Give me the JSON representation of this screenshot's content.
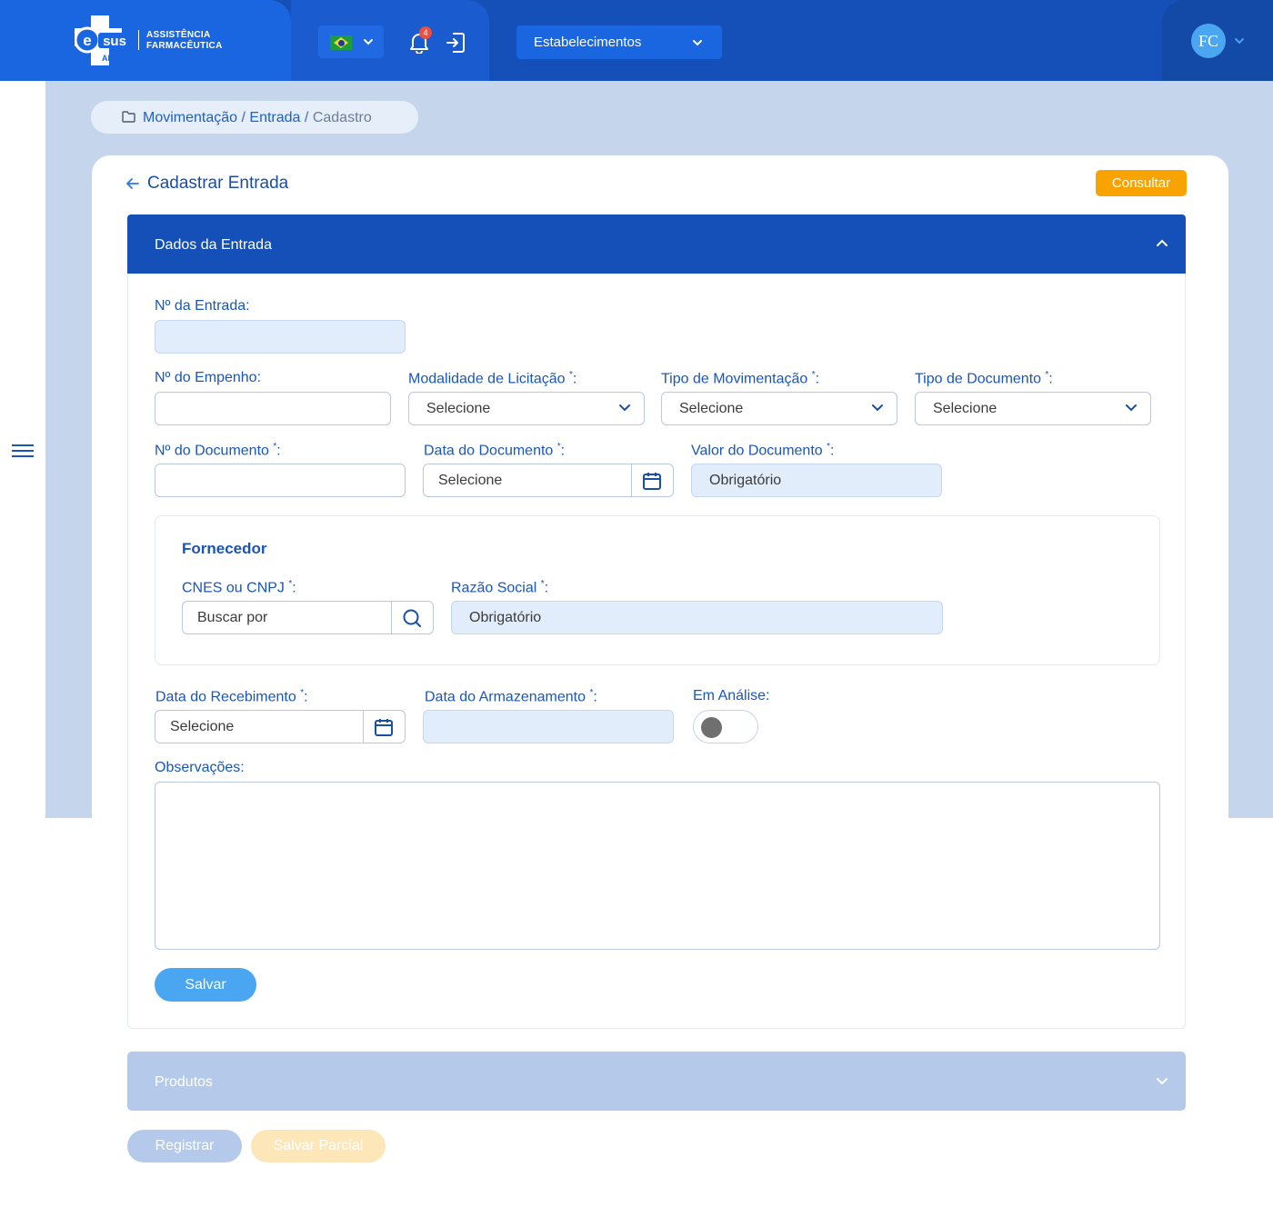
{
  "header": {
    "logo_line1": "ASSISTÊNCIA",
    "logo_line2": "FARMACÊUTICA",
    "logo_brand": "sus",
    "logo_sub": "AF",
    "notification_count": "4",
    "establishment_label": "Estabelecimentos",
    "user_initials": "FC"
  },
  "breadcrumb": {
    "items": [
      "Movimentação",
      "Entrada",
      "Cadastro"
    ],
    "separator": "/"
  },
  "page": {
    "title": "Cadastrar Entrada",
    "consult_button": "Consultar"
  },
  "section": {
    "title": "Dados da Entrada"
  },
  "form": {
    "numero_entrada": {
      "label": "Nº da Entrada:",
      "value": ""
    },
    "numero_empenho": {
      "label": "Nº do Empenho:",
      "value": ""
    },
    "modalidade": {
      "label": "Modalidade de Licitação ",
      "req": "*",
      "colon": ":",
      "value": "Selecione"
    },
    "tipo_mov": {
      "label": "Tipo de Movimentação ",
      "req": "*",
      "colon": ":",
      "value": "Selecione"
    },
    "tipo_doc": {
      "label": "Tipo de Documento ",
      "req": "*",
      "colon": ":",
      "value": "Selecione"
    },
    "numero_doc": {
      "label": "Nº do Documento ",
      "req": "*",
      "colon": ":",
      "value": ""
    },
    "data_doc": {
      "label": "Data do Documento ",
      "req": "*",
      "colon": ":",
      "value": "Selecione"
    },
    "valor_doc": {
      "label": "Valor do Documento ",
      "req": "*",
      "colon": ":",
      "value": "Obrigatório"
    },
    "fornecedor": {
      "title": "Fornecedor",
      "cnes": {
        "label": "CNES ou CNPJ ",
        "req": "*",
        "colon": ":",
        "placeholder": "Buscar por"
      },
      "razao": {
        "label": "Razão Social ",
        "req": "*",
        "colon": ":",
        "value": "Obrigatório"
      }
    },
    "data_receb": {
      "label": "Data do Recebimento ",
      "req": "*",
      "colon": ":",
      "value": "Selecione"
    },
    "data_armaz": {
      "label": "Data do Armazenamento ",
      "req": "*",
      "colon": ":",
      "value": ""
    },
    "em_analise": {
      "label": "Em Análise:",
      "checked": false
    },
    "observacoes": {
      "label": "Observações:",
      "value": ""
    },
    "save_button": "Salvar"
  },
  "produtos": {
    "title": "Produtos"
  },
  "footer": {
    "register_button": "Registrar",
    "partial_button": "Salvar Parcial"
  },
  "colors": {
    "header_blue": "#1550b8",
    "accent_orange": "#f8a300",
    "light_blue": "#4aa6f0",
    "page_bg": "#c5d5ec"
  }
}
